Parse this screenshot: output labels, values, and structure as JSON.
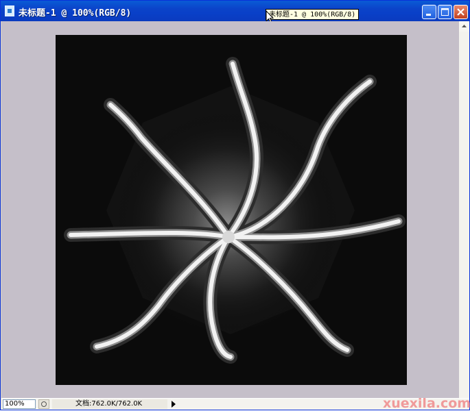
{
  "window": {
    "title": "未标题-1 @ 100%(RGB/8)",
    "tooltip": "未标题-1 @ 100%(RGB/8)"
  },
  "icons": [
    "document-icon",
    "minimize-icon",
    "maximize-icon",
    "close-icon",
    "cursor-icon",
    "info-icon",
    "triangle-right-icon",
    "scroll-up-icon"
  ],
  "colors": {
    "titlebar": "#0b43c9",
    "canvas_bg": "#c5bfc9",
    "document_bg": "#0b0b0b",
    "close": "#c1401f"
  },
  "status": {
    "zoom": "100%",
    "doc_info": "文档:762.0K/762.0K"
  },
  "watermark": "xuexila.com"
}
